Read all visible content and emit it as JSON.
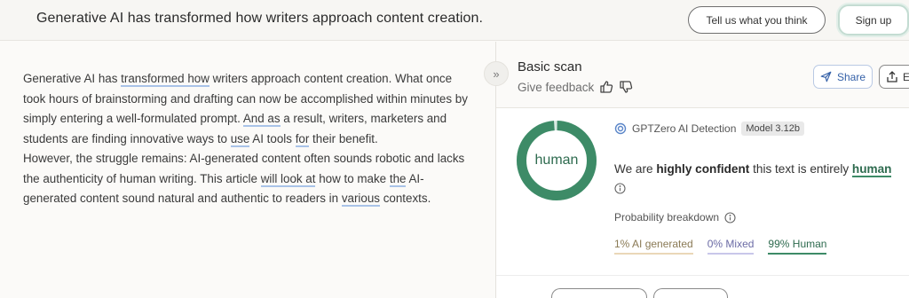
{
  "topbar": {
    "title": "Generative AI has transformed how writers approach content creation.",
    "feedback_button": "Tell us what you think",
    "signup_button": "Sign up"
  },
  "article": {
    "paragraph1": [
      {
        "text": "Generative AI has ",
        "hl": false
      },
      {
        "text": "transformed how",
        "hl": true
      },
      {
        "text": " writers approach content creation. What once took hours of brainstorming and drafting can now be accomplished within minutes by simply entering a well-formulated prompt. ",
        "hl": false
      },
      {
        "text": "And as",
        "hl": true
      },
      {
        "text": " a result, writers, marketers and students are finding innovative ways to ",
        "hl": false
      },
      {
        "text": "use",
        "hl": true
      },
      {
        "text": " AI tools ",
        "hl": false
      },
      {
        "text": "for",
        "hl": true
      },
      {
        "text": " their benefit.",
        "hl": false
      }
    ],
    "paragraph2": [
      {
        "text": "However, the struggle remains: AI-generated content often sounds robotic and lacks the authenticity of human writing. This article ",
        "hl": false
      },
      {
        "text": "will look at",
        "hl": true
      },
      {
        "text": " how to make ",
        "hl": false
      },
      {
        "text": "the",
        "hl": true
      },
      {
        "text": " AI-generated content sound natural and authentic to readers in ",
        "hl": false
      },
      {
        "text": "various",
        "hl": true
      },
      {
        "text": " contexts.",
        "hl": false
      }
    ]
  },
  "collapse": {
    "glyph": "»"
  },
  "panel": {
    "title": "Basic scan",
    "give_feedback": "Give feedback",
    "share_label": "Share",
    "more_label": "E",
    "donut_label": "human",
    "human_fraction": 0.99,
    "detector_name": "GPTZero AI Detection",
    "model_badge": "Model 3.12b",
    "confidence_prefix": "We are ",
    "confidence_bold": "highly confident",
    "confidence_mid": " this text is entirely ",
    "confidence_result": "human",
    "probability_label": "Probability breakdown",
    "breakdown": {
      "ai": "1% AI generated",
      "mixed": "0% Mixed",
      "human": "99% Human"
    },
    "colors": {
      "human": "#3d8b67",
      "donut_track": "#d9ebe2"
    }
  }
}
